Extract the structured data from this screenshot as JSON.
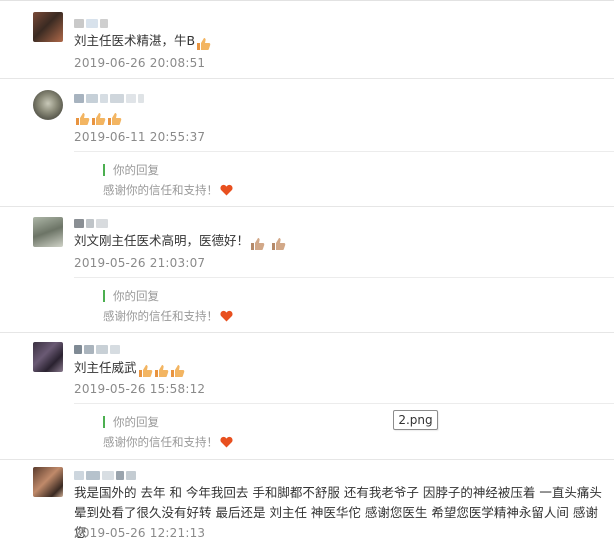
{
  "reviews": [
    {
      "content": "刘主任医术精湛，牛B",
      "date": "2019-06-26 20:08:51",
      "thumbs": 1
    },
    {
      "content": "",
      "date": "2019-06-11 20:55:37",
      "thumbs": 3,
      "reply": {
        "title": "你的回复",
        "text": "感谢你的信任和支持！"
      }
    },
    {
      "content": "刘文刚主任医术高明，医德好！",
      "date": "2019-05-26 21:03:07",
      "thumbs": 2,
      "reply": {
        "title": "你的回复",
        "text": "感谢你的信任和支持！"
      }
    },
    {
      "content": "刘主任威武",
      "date": "2019-05-26 15:58:12",
      "thumbs": 3,
      "reply": {
        "title": "你的回复",
        "text": "感谢你的信任和支持！"
      }
    },
    {
      "content": "我是国外的 去年 和 今年我回去 手和脚都不舒服 还有我老爷子 因脖子的神经被压着 一直头痛头晕到处看了很久没有好转 最后还是 刘主任 神医华佗 感谢您医生 希望您医学精神永留人间 感谢您",
      "date": "2019-05-26 12:21:13"
    }
  ],
  "tooltip": {
    "text": "2.png"
  },
  "icons": {
    "thumb": "thumbs-up-icon",
    "heart": "heart-icon"
  },
  "colors": {
    "reply_bar": "#4caf50",
    "heart": "#e8501f",
    "thumb": "#f0a74f"
  }
}
